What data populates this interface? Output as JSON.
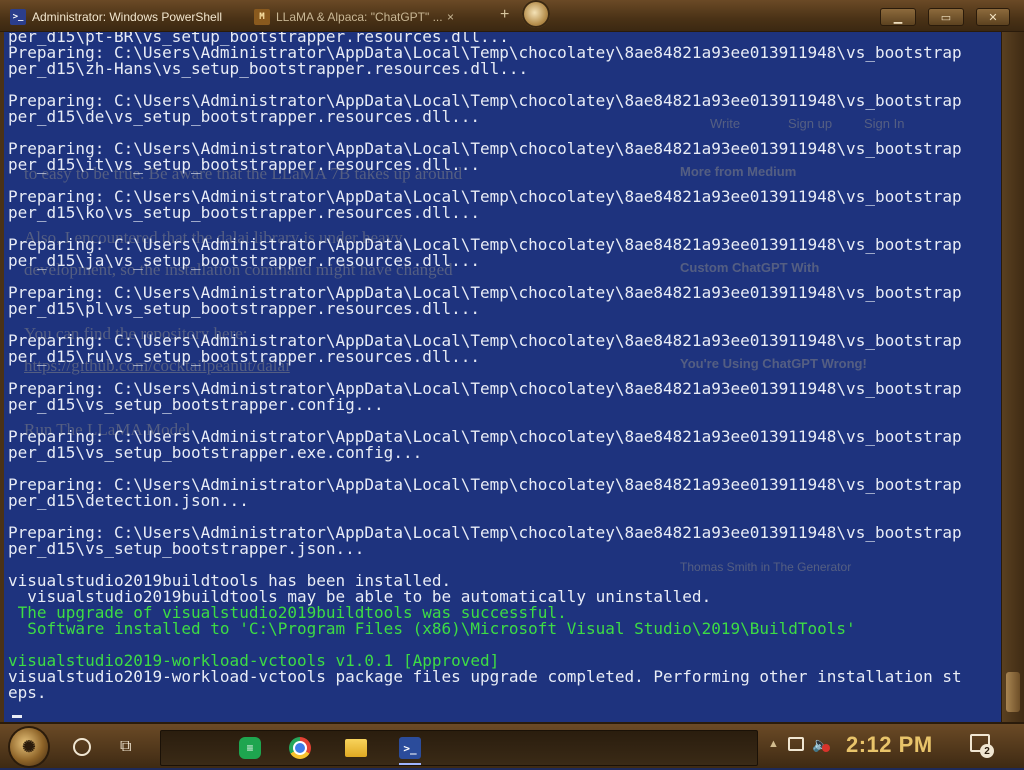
{
  "titlebar": {
    "active_tab": "Administrator: Windows PowerShell",
    "active_tab_icon": "powershell-icon",
    "inactive_tab": "LLaMA & Alpaca: \"ChatGPT\" ...",
    "inactive_tab_icon": "medium-icon",
    "close_glyph": "×",
    "new_tab_glyph": "+",
    "buttons": [
      "minimize",
      "maximize",
      "close"
    ]
  },
  "console": {
    "lines": [
      {
        "text": "per_d15\\pt-BR\\vs_setup_bootstrapper.resources.dll...",
        "color": "white"
      },
      {
        "text": "Preparing: C:\\Users\\Administrator\\AppData\\Local\\Temp\\chocolatey\\8ae84821a93ee013911948\\vs_bootstrap",
        "color": "white"
      },
      {
        "text": "per_d15\\zh-Hans\\vs_setup_bootstrapper.resources.dll...",
        "color": "white"
      },
      {
        "text": "",
        "color": "white"
      },
      {
        "text": "Preparing: C:\\Users\\Administrator\\AppData\\Local\\Temp\\chocolatey\\8ae84821a93ee013911948\\vs_bootstrap",
        "color": "white"
      },
      {
        "text": "per_d15\\de\\vs_setup_bootstrapper.resources.dll...",
        "color": "white"
      },
      {
        "text": "",
        "color": "white"
      },
      {
        "text": "Preparing: C:\\Users\\Administrator\\AppData\\Local\\Temp\\chocolatey\\8ae84821a93ee013911948\\vs_bootstrap",
        "color": "white"
      },
      {
        "text": "per_d15\\it\\vs_setup_bootstrapper.resources.dll...",
        "color": "white"
      },
      {
        "text": "",
        "color": "white"
      },
      {
        "text": "Preparing: C:\\Users\\Administrator\\AppData\\Local\\Temp\\chocolatey\\8ae84821a93ee013911948\\vs_bootstrap",
        "color": "white"
      },
      {
        "text": "per_d15\\ko\\vs_setup_bootstrapper.resources.dll...",
        "color": "white"
      },
      {
        "text": "",
        "color": "white"
      },
      {
        "text": "Preparing: C:\\Users\\Administrator\\AppData\\Local\\Temp\\chocolatey\\8ae84821a93ee013911948\\vs_bootstrap",
        "color": "white"
      },
      {
        "text": "per_d15\\ja\\vs_setup_bootstrapper.resources.dll...",
        "color": "white"
      },
      {
        "text": "",
        "color": "white"
      },
      {
        "text": "Preparing: C:\\Users\\Administrator\\AppData\\Local\\Temp\\chocolatey\\8ae84821a93ee013911948\\vs_bootstrap",
        "color": "white"
      },
      {
        "text": "per_d15\\pl\\vs_setup_bootstrapper.resources.dll...",
        "color": "white"
      },
      {
        "text": "",
        "color": "white"
      },
      {
        "text": "Preparing: C:\\Users\\Administrator\\AppData\\Local\\Temp\\chocolatey\\8ae84821a93ee013911948\\vs_bootstrap",
        "color": "white"
      },
      {
        "text": "per_d15\\ru\\vs_setup_bootstrapper.resources.dll...",
        "color": "white"
      },
      {
        "text": "",
        "color": "white"
      },
      {
        "text": "Preparing: C:\\Users\\Administrator\\AppData\\Local\\Temp\\chocolatey\\8ae84821a93ee013911948\\vs_bootstrap",
        "color": "white"
      },
      {
        "text": "per_d15\\vs_setup_bootstrapper.config...",
        "color": "white"
      },
      {
        "text": "",
        "color": "white"
      },
      {
        "text": "Preparing: C:\\Users\\Administrator\\AppData\\Local\\Temp\\chocolatey\\8ae84821a93ee013911948\\vs_bootstrap",
        "color": "white"
      },
      {
        "text": "per_d15\\vs_setup_bootstrapper.exe.config...",
        "color": "white"
      },
      {
        "text": "",
        "color": "white"
      },
      {
        "text": "Preparing: C:\\Users\\Administrator\\AppData\\Local\\Temp\\chocolatey\\8ae84821a93ee013911948\\vs_bootstrap",
        "color": "white"
      },
      {
        "text": "per_d15\\detection.json...",
        "color": "white"
      },
      {
        "text": "",
        "color": "white"
      },
      {
        "text": "Preparing: C:\\Users\\Administrator\\AppData\\Local\\Temp\\chocolatey\\8ae84821a93ee013911948\\vs_bootstrap",
        "color": "white"
      },
      {
        "text": "per_d15\\vs_setup_bootstrapper.json...",
        "color": "white"
      },
      {
        "text": "",
        "color": "white"
      },
      {
        "text": "visualstudio2019buildtools has been installed.",
        "color": "white"
      },
      {
        "text": "  visualstudio2019buildtools may be able to be automatically uninstalled.",
        "color": "white"
      },
      {
        "text": " The upgrade of visualstudio2019buildtools was successful.",
        "color": "green"
      },
      {
        "text": "  Software installed to 'C:\\Program Files (x86)\\Microsoft Visual Studio\\2019\\BuildTools'",
        "color": "green"
      },
      {
        "text": "",
        "color": "white"
      },
      {
        "text": "visualstudio2019-workload-vctools v1.0.1 [Approved]",
        "color": "green"
      },
      {
        "text": "visualstudio2019-workload-vctools package files upgrade completed. Performing other installation st",
        "color": "white"
      },
      {
        "text": "eps.",
        "color": "white"
      }
    ]
  },
  "background_page": {
    "left_lines": [
      "to easy to be true. Be aware that the LLaMA 7B takes up around",
      "Also, I encountered that the dalai library is under heavy",
      "development, so the installation command might have changed",
      "You can find the repository here:",
      "https://github.com/cocktailpeanut/dalai",
      "Run The LLaMA Model"
    ],
    "right_lines": [
      "Write",
      "Sign up",
      "Sign In",
      "More from Medium",
      "Custom ChatGPT With",
      "You're Using ChatGPT Wrong!",
      "Thomas Smith in The Generator"
    ]
  },
  "taskbar": {
    "start_glyph": "✺",
    "taskview_glyph": "⧉",
    "apps": [
      {
        "name": "sheets",
        "glyph": "≡"
      },
      {
        "name": "chrome",
        "glyph": ""
      },
      {
        "name": "explorer",
        "glyph": ""
      },
      {
        "name": "powershell",
        "glyph": ">_"
      }
    ],
    "tray_chevron": "▲",
    "volume_glyph": "🔈",
    "clock": "2:12 PM",
    "notification_count": "2"
  },
  "colors": {
    "console_bg": "#1e3480",
    "console_text": "#e8ecf6",
    "console_green": "#3ddc44",
    "titlebar": "#4a3216",
    "clock": "#e9c46a"
  }
}
